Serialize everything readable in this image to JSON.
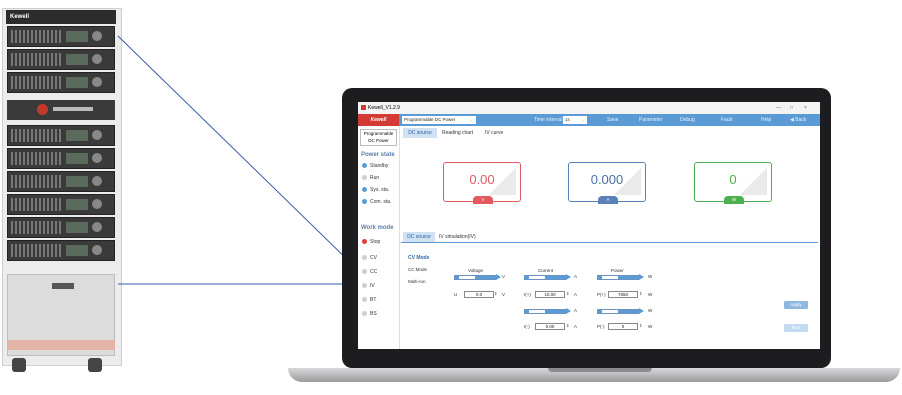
{
  "rack": {
    "brand": "Kewell"
  },
  "app": {
    "title": "Kewell_V1.2.9",
    "window_controls": [
      "—",
      "□",
      "×"
    ],
    "brand": "Kewell",
    "mode_select": "Programmable DC Power",
    "time_interval_label": "Time interval",
    "time_interval_value": "1s",
    "menu": {
      "save": "Save",
      "parameter": "Parameter",
      "debug": "Debug",
      "fault": "Fault",
      "help": "Help",
      "back": "Back"
    }
  },
  "sidebar": {
    "device_line1": "Programmable",
    "device_line2": "DC Power",
    "power_state_title": "Power state",
    "power_states": [
      {
        "label": "Standby",
        "color": "#5b9bd5"
      },
      {
        "label": "Run",
        "color": "#cfcfcf"
      },
      {
        "label": "Sys. sta.",
        "color": "#5b9bd5"
      },
      {
        "label": "Com. sta.",
        "color": "#5b9bd5"
      }
    ],
    "work_mode_title": "Work mode",
    "work_modes": [
      {
        "label": "Stop",
        "color": "#e03c3c"
      },
      {
        "label": "CV",
        "color": "#cfcfcf"
      },
      {
        "label": "CC",
        "color": "#cfcfcf"
      },
      {
        "label": "IV",
        "color": "#cfcfcf"
      },
      {
        "label": "BT",
        "color": "#cfcfcf"
      },
      {
        "label": "BS",
        "color": "#cfcfcf"
      }
    ]
  },
  "top_tabs": [
    "DC source",
    "Reading chart",
    "IV curve"
  ],
  "gauges": [
    {
      "value": "0.00",
      "unit": "V",
      "color": "#e05a60"
    },
    {
      "value": "0.000",
      "unit": "A",
      "color": "#5b82b8"
    },
    {
      "value": "0",
      "unit": "W",
      "color": "#4cb050"
    }
  ],
  "bottom_tabs": [
    "DC source",
    "IV simulation(IV)"
  ],
  "control": {
    "cv_mode": "CV Mode",
    "cc_mode": "CC Mode",
    "multi_run": "Multi-run",
    "voltage_title": "Voltage",
    "current_title": "Current",
    "power_title": "Power",
    "v_unit": "V",
    "a_unit": "A",
    "w_unit": "W",
    "u_label": "U",
    "u_value": "0.0",
    "i_plus_label": "I(+)",
    "i_plus_value": "10.00",
    "p_plus_label": "P(+)",
    "p_plus_value": "7650",
    "i_minus_label": "I(-)",
    "i_minus_value": "0.00",
    "p_minus_label": "P(-)",
    "p_minus_value": "0",
    "apply": "Apply",
    "run": "Run"
  }
}
